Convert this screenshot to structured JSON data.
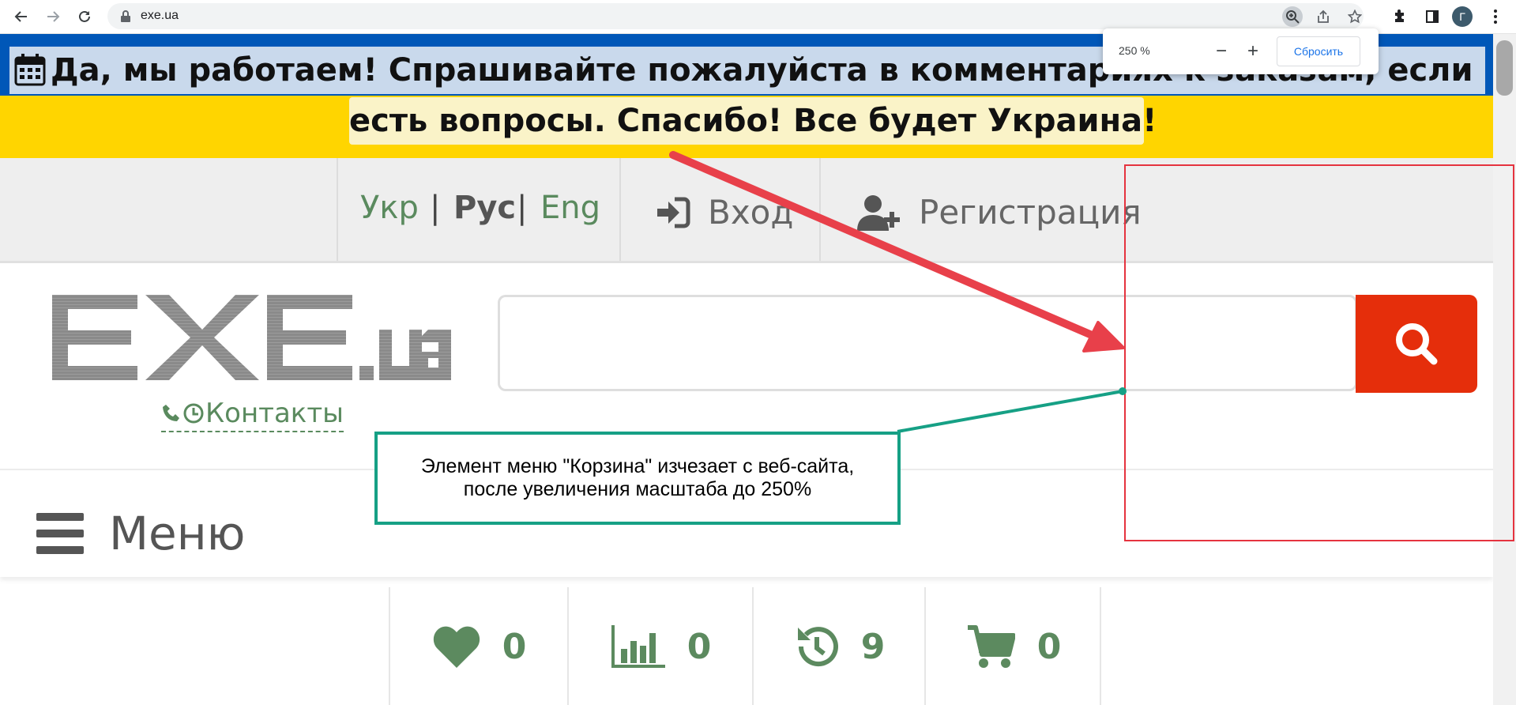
{
  "browser": {
    "url": "exe.ua",
    "avatar_letter": "Г",
    "zoom_popup": {
      "percent": "250 %",
      "minus": "−",
      "plus": "+",
      "reset_label": "Сбросить"
    }
  },
  "banner": {
    "line1": "Да, мы работаем! Спрашивайте пожалуйста в комментариях к заказам, если",
    "line2": "есть вопросы. Спасибо! Все будет Украина!",
    "colors": {
      "top": "#0057b8",
      "bottom": "#ffd500"
    }
  },
  "topbar": {
    "lang_ukr": "Укр",
    "lang_sep1": "|",
    "lang_rus": "Рус",
    "lang_sep2": "|",
    "lang_eng": "Eng",
    "login_label": "Вход",
    "register_label": "Регистрация"
  },
  "header": {
    "logo_text_main": "EXE",
    "logo_text_suffix": ".ua",
    "contacts_label": "Контакты",
    "search_value": "",
    "search_color": "#e52e0b"
  },
  "menu": {
    "label": "Меню"
  },
  "counters": [
    {
      "icon": "heart-icon",
      "value": "0"
    },
    {
      "icon": "compare-chart-icon",
      "value": "0"
    },
    {
      "icon": "history-icon",
      "value": "9"
    },
    {
      "icon": "cart-icon",
      "value": "0"
    }
  ],
  "annotation": {
    "callout_line1": "Элемент меню \"Корзина\" изчезает с веб-сайта,",
    "callout_line2": "после увеличения масштаба до 250%"
  }
}
